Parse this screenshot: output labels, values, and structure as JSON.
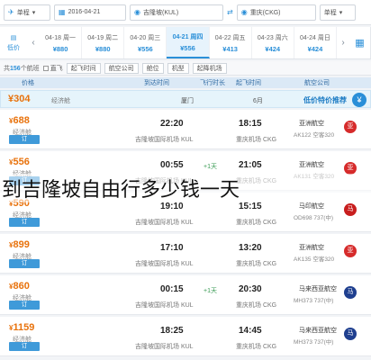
{
  "search": {
    "trip_type": "单程",
    "from_city": "重庆(CKG)",
    "to_city": "吉隆坡(KUL)",
    "date_from": "2016-04-21",
    "date_to": "2016-04-21",
    "swap_icon": "swap-icon",
    "sep": "一 一",
    "tag": "吉隆坡"
  },
  "date_strip": {
    "calendar_label": "日历",
    "days": [
      {
        "date": "04-18 周一",
        "price": "¥880"
      },
      {
        "date": "04-19 周二",
        "price": "¥880"
      },
      {
        "date": "04-20 周三",
        "price": "¥556"
      },
      {
        "date": "04-21 周四",
        "price": "¥556",
        "active": true
      },
      {
        "date": "04-22 周五",
        "price": "¥413"
      },
      {
        "date": "04-23 周六",
        "price": "¥424"
      },
      {
        "date": "04-24 周日",
        "price": "¥424"
      }
    ],
    "low_label": "低价",
    "low_sub": "日历"
  },
  "filters": {
    "items": [
      "起飞时间",
      "航空公司",
      "舱位",
      "机型",
      "起降机场"
    ],
    "direct": "直飞",
    "count_prefix": "共",
    "count": "156",
    "count_suffix": "个航班"
  },
  "columns": {
    "price": "价格",
    "arrival": "到达时间",
    "duration": "飞行时长",
    "departure": "起飞时间",
    "airline": "航空公司"
  },
  "low_banner": {
    "price": "¥304",
    "text": "经济舱",
    "city": "厦门",
    "date": "6月",
    "title": "低价特价推荐",
    "badge": "¥"
  },
  "flights": [
    {
      "price": "688",
      "cabin": "经济舱",
      "book": "订",
      "arr_time": "22:20",
      "arr_apt": "吉隆坡国际机场 KUL",
      "dur": "",
      "dep_time": "18:15",
      "dep_apt": "重庆机场 CKG",
      "airline": "亚洲航空",
      "fno": "AK122 空客320",
      "logo_color": "#d62b2b",
      "logo": "亚"
    },
    {
      "price": "556",
      "cabin": "经济舱",
      "book": "订",
      "arr_time": "00:55",
      "arr_apt": "吉隆坡国际机场 KUL",
      "dur": "+1天",
      "dep_time": "21:05",
      "dep_apt": "重庆机场 CKG",
      "airline": "亚洲航空",
      "fno": "AK131 空客320",
      "logo_color": "#d62b2b",
      "logo": "亚"
    },
    {
      "price": "590",
      "cabin": "经济舱",
      "book": "订",
      "arr_time": "19:10",
      "arr_apt": "吉隆坡国际机场 KUL",
      "dur": "",
      "dep_time": "15:15",
      "dep_apt": "重庆机场 CKG",
      "airline": "马印航空",
      "fno": "OD698 737(中)",
      "logo_color": "#c81e1e",
      "logo": "马"
    },
    {
      "price": "899",
      "cabin": "经济舱",
      "book": "订",
      "arr_time": "17:10",
      "arr_apt": "吉隆坡国际机场 KUL",
      "dur": "",
      "dep_time": "13:20",
      "dep_apt": "重庆机场 CKG",
      "airline": "亚洲航空",
      "fno": "AK135 空客320",
      "logo_color": "#d62b2b",
      "logo": "亚"
    },
    {
      "price": "860",
      "cabin": "经济舱",
      "book": "订",
      "arr_time": "00:15",
      "arr_apt": "吉隆坡国际机场 KUL",
      "dur": "+1天",
      "dep_time": "20:30",
      "dep_apt": "重庆机场 CKG",
      "airline": "马来西亚航空",
      "fno": "MH373 737(中)",
      "logo_color": "#1f3f8f",
      "logo": "马"
    },
    {
      "price": "1159",
      "cabin": "经济舱",
      "book": "订",
      "arr_time": "18:25",
      "arr_apt": "吉隆坡国际机场 KUL",
      "dur": "",
      "dep_time": "14:45",
      "dep_apt": "重庆机场 CKG",
      "airline": "马来西亚航空",
      "fno": "MH373 737(中)",
      "logo_color": "#1f3f8f",
      "logo": "马"
    }
  ],
  "overlay_text": "到吉隆坡自由行多少钱一天"
}
